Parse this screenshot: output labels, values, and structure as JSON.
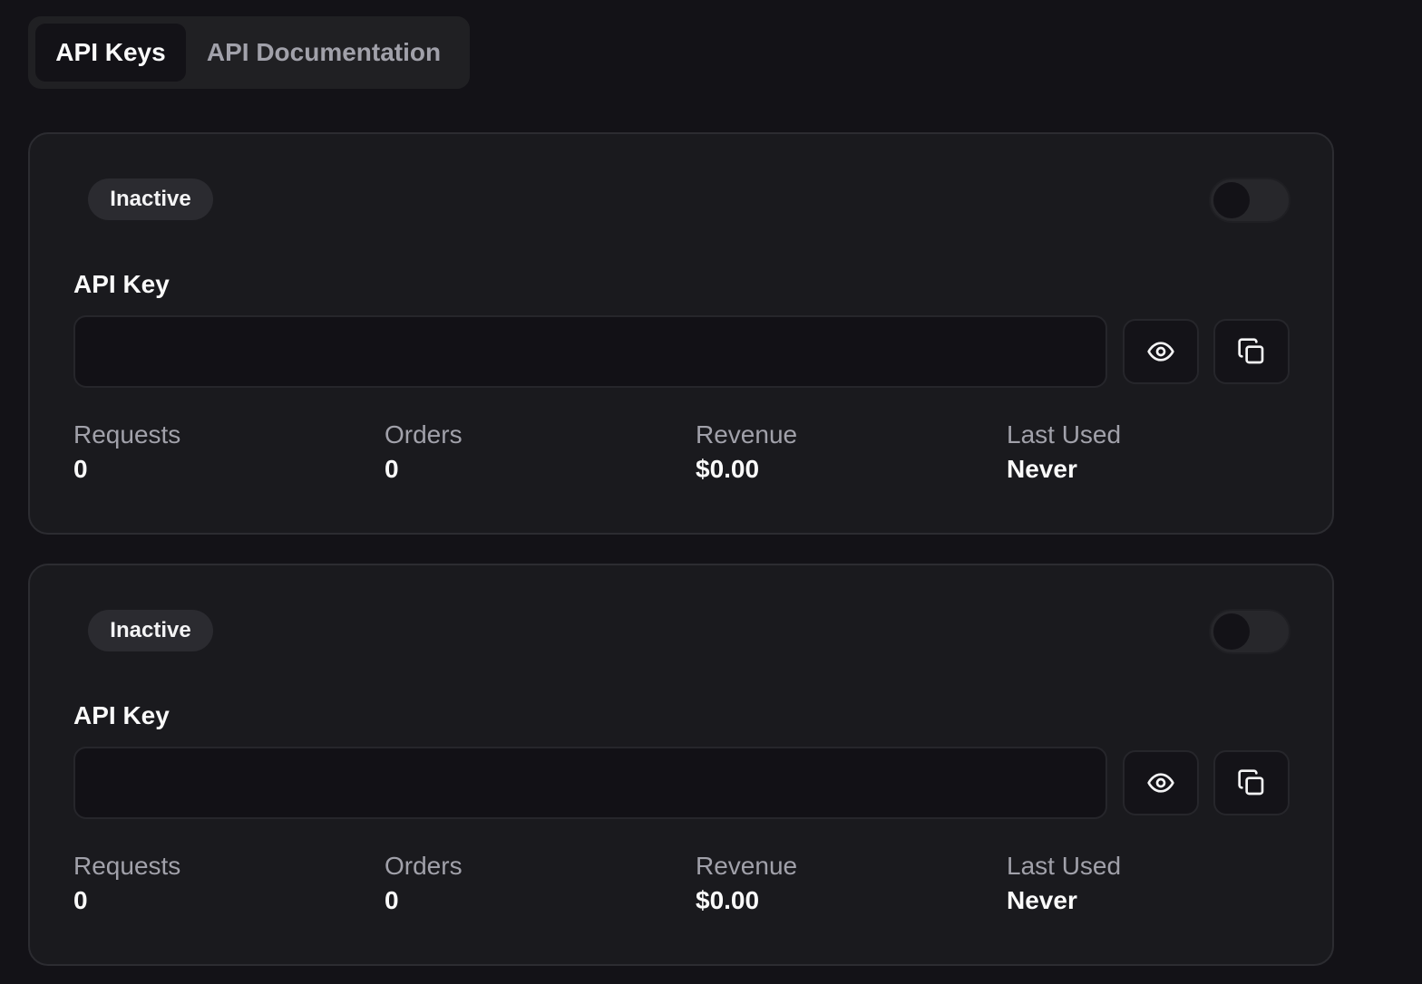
{
  "tabs": [
    {
      "label": "API Keys",
      "active": true
    },
    {
      "label": "API Documentation",
      "active": false
    }
  ],
  "cards": [
    {
      "status": "Inactive",
      "enabled": false,
      "key_label": "API Key",
      "key_value": "",
      "stats": {
        "requests": {
          "label": "Requests",
          "value": "0"
        },
        "orders": {
          "label": "Orders",
          "value": "0"
        },
        "revenue": {
          "label": "Revenue",
          "value": "$0.00"
        },
        "last_used": {
          "label": "Last Used",
          "value": "Never"
        }
      }
    },
    {
      "status": "Inactive",
      "enabled": false,
      "key_label": "API Key",
      "key_value": "",
      "stats": {
        "requests": {
          "label": "Requests",
          "value": "0"
        },
        "orders": {
          "label": "Orders",
          "value": "0"
        },
        "revenue": {
          "label": "Revenue",
          "value": "$0.00"
        },
        "last_used": {
          "label": "Last Used",
          "value": "Never"
        }
      }
    }
  ],
  "icons": {
    "reveal": "eye-icon",
    "copy": "copy-icon"
  },
  "colors": {
    "background": "#131217",
    "card": "#1a1a1e",
    "muted_text": "#a1a1aa",
    "text": "#fafafa"
  }
}
